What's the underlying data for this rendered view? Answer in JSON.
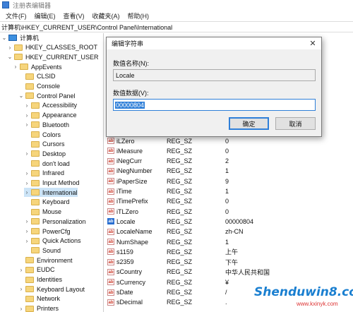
{
  "window": {
    "title": "注册表编辑器"
  },
  "menu": [
    "文件(F)",
    "编辑(E)",
    "查看(V)",
    "收藏夹(A)",
    "帮助(H)"
  ],
  "address": "计算机\\HKEY_CURRENT_USER\\Control Panel\\International",
  "tree": [
    {
      "label": "计算机",
      "chevron": "⌄",
      "icon": "pc",
      "selected": false
    },
    {
      "label": "HKEY_CLASSES_ROOT",
      "chevron": "›",
      "icon": "folder",
      "selected": false
    },
    {
      "label": "HKEY_CURRENT_USER",
      "chevron": "⌄",
      "icon": "folder",
      "selected": false
    },
    {
      "label": "AppEvents",
      "chevron": "›",
      "icon": "folder",
      "selected": false
    },
    {
      "label": "CLSID",
      "chevron": "",
      "icon": "folder",
      "selected": false
    },
    {
      "label": "Console",
      "chevron": "",
      "icon": "folder",
      "selected": false
    },
    {
      "label": "Control Panel",
      "chevron": "⌄",
      "icon": "folder",
      "selected": false
    },
    {
      "label": "Accessibility",
      "chevron": "›",
      "icon": "folder",
      "selected": false
    },
    {
      "label": "Appearance",
      "chevron": "›",
      "icon": "folder",
      "selected": false
    },
    {
      "label": "Bluetooth",
      "chevron": "›",
      "icon": "folder",
      "selected": false
    },
    {
      "label": "Colors",
      "chevron": "",
      "icon": "folder",
      "selected": false
    },
    {
      "label": "Cursors",
      "chevron": "",
      "icon": "folder",
      "selected": false
    },
    {
      "label": "Desktop",
      "chevron": "›",
      "icon": "folder",
      "selected": false
    },
    {
      "label": "don't load",
      "chevron": "",
      "icon": "folder",
      "selected": false
    },
    {
      "label": "Infrared",
      "chevron": "›",
      "icon": "folder",
      "selected": false
    },
    {
      "label": "Input Method",
      "chevron": "›",
      "icon": "folder",
      "selected": false
    },
    {
      "label": "International",
      "chevron": "›",
      "icon": "folder",
      "selected": true
    },
    {
      "label": "Keyboard",
      "chevron": "",
      "icon": "folder",
      "selected": false
    },
    {
      "label": "Mouse",
      "chevron": "",
      "icon": "folder",
      "selected": false
    },
    {
      "label": "Personalization",
      "chevron": "›",
      "icon": "folder",
      "selected": false
    },
    {
      "label": "PowerCfg",
      "chevron": "›",
      "icon": "folder",
      "selected": false
    },
    {
      "label": "Quick Actions",
      "chevron": "›",
      "icon": "folder",
      "selected": false
    },
    {
      "label": "Sound",
      "chevron": "",
      "icon": "folder",
      "selected": false
    },
    {
      "label": "Environment",
      "chevron": "",
      "icon": "folder",
      "selected": false
    },
    {
      "label": "EUDC",
      "chevron": "›",
      "icon": "folder",
      "selected": false
    },
    {
      "label": "Identities",
      "chevron": "",
      "icon": "folder",
      "selected": false
    },
    {
      "label": "Keyboard Layout",
      "chevron": "›",
      "icon": "folder",
      "selected": false
    },
    {
      "label": "Network",
      "chevron": "",
      "icon": "folder",
      "selected": false
    },
    {
      "label": "Printers",
      "chevron": "›",
      "icon": "folder",
      "selected": false
    }
  ],
  "values": [
    {
      "name": "iLZero",
      "type": "REG_SZ",
      "data": "0",
      "icon": "ab"
    },
    {
      "name": "iMeasure",
      "type": "REG_SZ",
      "data": "0",
      "icon": "ab"
    },
    {
      "name": "iNegCurr",
      "type": "REG_SZ",
      "data": "2",
      "icon": "ab"
    },
    {
      "name": "iNegNumber",
      "type": "REG_SZ",
      "data": "1",
      "icon": "ab"
    },
    {
      "name": "iPaperSize",
      "type": "REG_SZ",
      "data": "9",
      "icon": "ab"
    },
    {
      "name": "iTime",
      "type": "REG_SZ",
      "data": "1",
      "icon": "ab"
    },
    {
      "name": "iTimePrefix",
      "type": "REG_SZ",
      "data": "0",
      "icon": "ab"
    },
    {
      "name": "iTLZero",
      "type": "REG_SZ",
      "data": "0",
      "icon": "ab"
    },
    {
      "name": "Locale",
      "type": "REG_SZ",
      "data": "00000804",
      "icon": "ab-selected"
    },
    {
      "name": "LocaleName",
      "type": "REG_SZ",
      "data": "zh-CN",
      "icon": "ab"
    },
    {
      "name": "NumShape",
      "type": "REG_SZ",
      "data": "1",
      "icon": "ab"
    },
    {
      "name": "s1159",
      "type": "REG_SZ",
      "data": "上午",
      "icon": "ab"
    },
    {
      "name": "s2359",
      "type": "REG_SZ",
      "data": "下午",
      "icon": "ab"
    },
    {
      "name": "sCountry",
      "type": "REG_SZ",
      "data": "中华人民共和国",
      "icon": "ab"
    },
    {
      "name": "sCurrency",
      "type": "REG_SZ",
      "data": "¥",
      "icon": "ab"
    },
    {
      "name": "sDate",
      "type": "REG_SZ",
      "data": "/",
      "icon": "ab"
    },
    {
      "name": "sDecimal",
      "type": "REG_SZ",
      "data": ".",
      "icon": "ab"
    }
  ],
  "dialog": {
    "title": "编辑字符串",
    "name_label": "数值名称(N):",
    "name_value": "Locale",
    "data_label": "数值数据(V):",
    "data_value": "00000804",
    "ok_label": "确定",
    "cancel_label": "取消",
    "close_glyph": "✕"
  },
  "watermark": {
    "main": "Shenduwin8.com",
    "sub": "www.kxinyk.com"
  },
  "colors": {
    "accent": "#2f7fd8",
    "selected_row": "#cce4f7",
    "folder": "#f6d57c"
  }
}
